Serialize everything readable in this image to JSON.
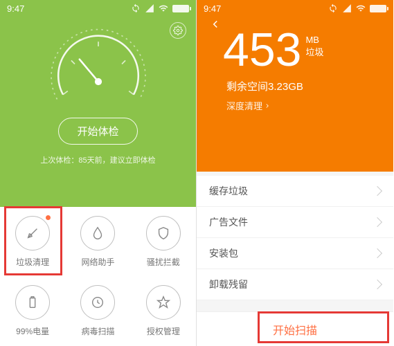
{
  "status": {
    "time": "9:47"
  },
  "left": {
    "check_button": "开始体检",
    "last_check": "上次体检：85天前，建议立即体检",
    "grid": [
      {
        "label": "垃圾清理"
      },
      {
        "label": "网络助手"
      },
      {
        "label": "骚扰拦截"
      },
      {
        "label": "99%电量"
      },
      {
        "label": "病毒扫描"
      },
      {
        "label": "授权管理"
      }
    ]
  },
  "right": {
    "number": "453",
    "unit": "MB",
    "unit_sub": "垃圾",
    "free_space": "剩余空间3.23GB",
    "deep_clean": "深度清理",
    "items": [
      "缓存垃圾",
      "广告文件",
      "安装包",
      "卸载残留"
    ],
    "scan_button": "开始扫描"
  }
}
